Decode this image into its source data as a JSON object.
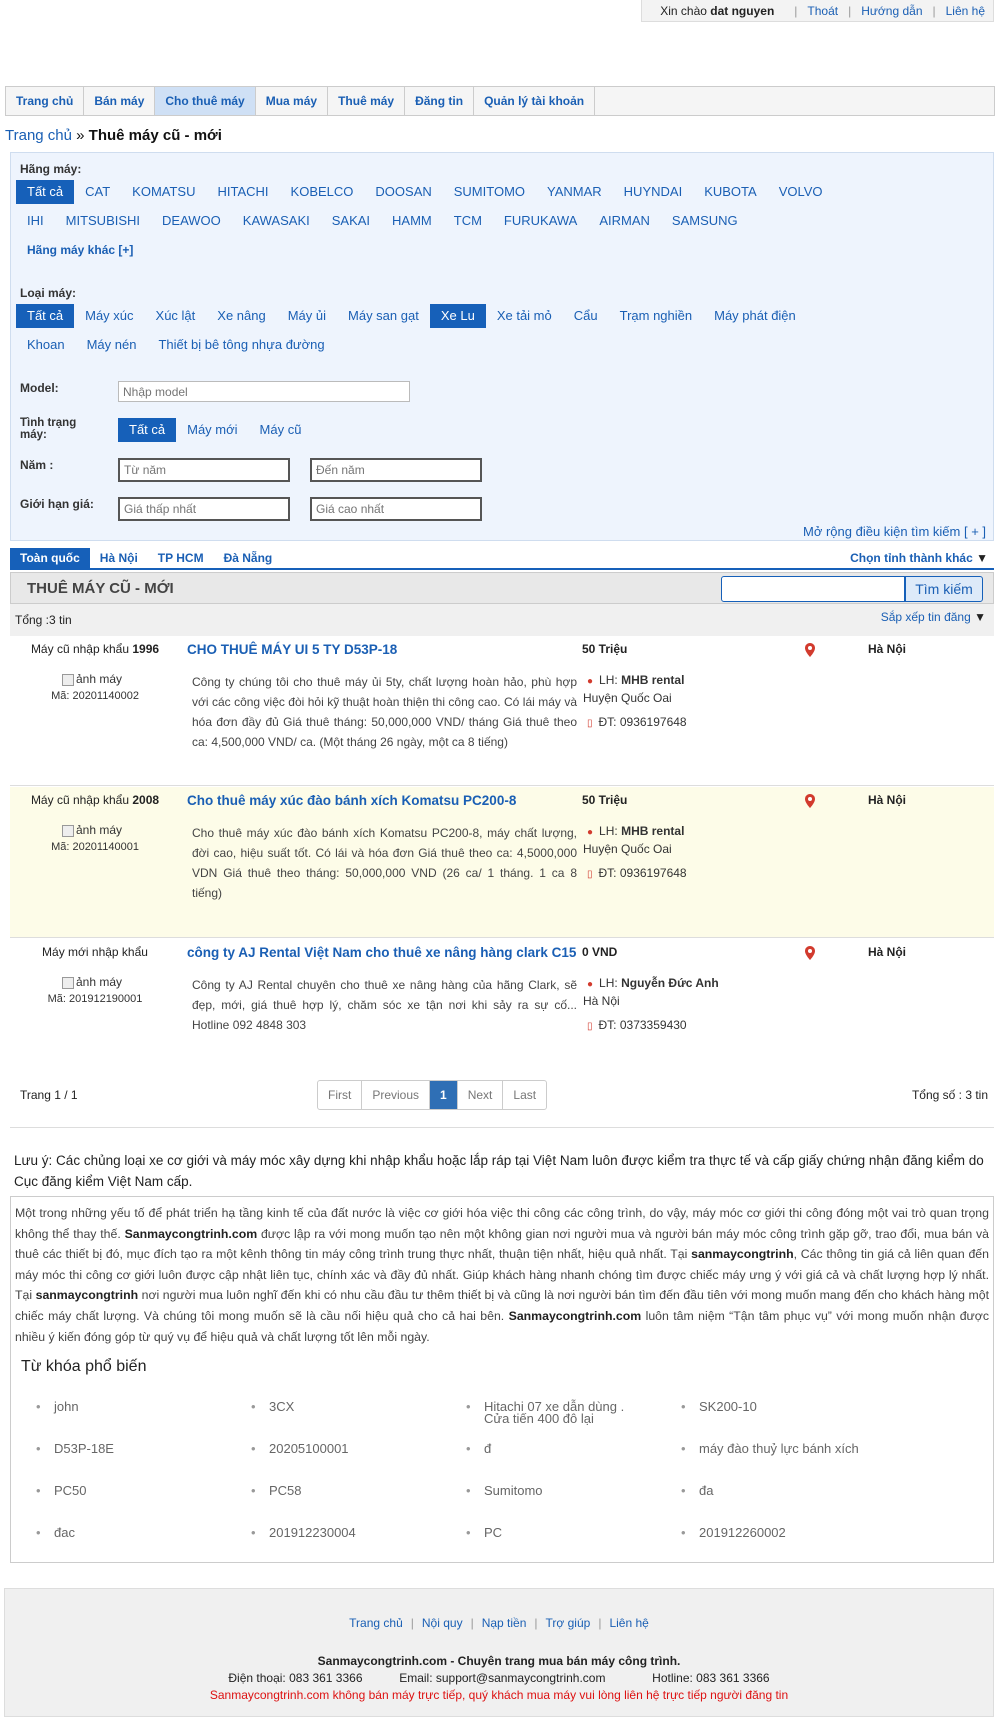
{
  "topbar": {
    "greeting": "Xin chào",
    "user": "dat nguyen",
    "logout": "Thoát",
    "guide": "Hướng dẫn",
    "contact": "Liên hệ"
  },
  "nav": [
    "Trang chủ",
    "Bán máy",
    "Cho thuê máy",
    "Mua máy",
    "Thuê máy",
    "Đăng tin",
    "Quản lý tài khoản"
  ],
  "breadcrumb": {
    "home": "Trang chủ",
    "sep": "»",
    "current": "Thuê máy cũ - mới"
  },
  "filters": {
    "brand_label": "Hãng máy:",
    "brands_row1": [
      "Tất cả",
      "CAT",
      "KOMATSU",
      "HITACHI",
      "KOBELCO",
      "DOOSAN",
      "SUMITOMO",
      "YANMAR",
      "HUYNDAI",
      "KUBOTA",
      "VOLVO"
    ],
    "brands_row2": [
      "IHI",
      "MITSUBISHI",
      "DEAWOO",
      "KAWASAKI",
      "SAKAI",
      "HAMM",
      "TCM",
      "FURUKAWA",
      "AIRMAN",
      "SAMSUNG"
    ],
    "brands_more": "Hãng máy khác [+]",
    "type_label": "Loại máy:",
    "types_row1": [
      "Tất cả",
      "Máy xúc",
      "Xúc lật",
      "Xe nâng",
      "Máy ủi",
      "Máy san gạt",
      "Xe Lu",
      "Xe tải mỏ",
      "Cẩu",
      "Trạm nghiền",
      "Máy phát điện"
    ],
    "types_row2": [
      "Khoan",
      "Máy nén",
      "Thiết bị bê tông nhựa đường"
    ],
    "model_label": "Model:",
    "model_placeholder": "Nhập model",
    "condition_label": "Tình trạng máy:",
    "conditions": [
      "Tất cả",
      "Máy mới",
      "Máy cũ"
    ],
    "year_label": "Năm :",
    "year_from": "Từ năm",
    "year_to": "Đến năm",
    "price_label": "Giới hạn giá:",
    "price_min": "Giá thấp nhất",
    "price_max": "Giá cao nhất",
    "expand": "Mở rộng điều kiện tìm kiếm [ + ]"
  },
  "regions": {
    "items": [
      "Toàn quốc",
      "Hà Nội",
      "TP HCM",
      "Đà Nẵng"
    ],
    "other": "Chọn tỉnh thành khác"
  },
  "list": {
    "title": "THUÊ MÁY CŨ - MỚI",
    "search_button": "Tìm kiếm",
    "total": "Tổng :3 tin",
    "sort": "Sắp xếp tin đăng"
  },
  "listings": [
    {
      "cond": "Máy cũ nhập khẩu",
      "year": "1996",
      "img_alt": "ảnh máy",
      "code": "Mã: 20201140002",
      "title": "CHO THUÊ MÁY UI 5 TY D53P-18",
      "desc": "Công ty chúng tôi cho thuê máy ủi 5ty, chất lượng hoàn hảo, phù hợp với các công việc đòi hỏi kỹ thuật hoàn thiện thi công cao. Có lái máy và hóa đơn đầy đủ Giá thuê tháng: 50,000,000 VND/ tháng Giá thuê theo ca: 4,500,000 VND/ ca. (Một tháng 26 ngày, một ca 8 tiếng)",
      "price": "50 Triệu",
      "contact_prefix": "LH:",
      "contact_name": "MHB rental",
      "address": "Huyện Quốc Oai",
      "phone": "ĐT: 0936197648",
      "location": "Hà Nội"
    },
    {
      "cond": "Máy cũ nhập khẩu",
      "year": "2008",
      "img_alt": "ảnh máy",
      "code": "Mã: 20201140001",
      "title": "Cho thuê máy xúc đào bánh xích Komatsu PC200-8",
      "desc": "Cho thuê máy xúc đào bánh xích Komatsu PC200-8, máy chất lượng, đời cao, hiệu suất tốt. Có lái và hóa đơn Giá thuê theo ca: 4,5000,000 VDN Giá thuê theo tháng: 50,000,000 VND (26 ca/ 1 tháng. 1 ca 8 tiếng)",
      "price": "50 Triệu",
      "contact_prefix": "LH:",
      "contact_name": "MHB rental",
      "address": "Huyện Quốc Oai",
      "phone": "ĐT: 0936197648",
      "location": "Hà Nội"
    },
    {
      "cond": "Máy mới nhập khẩu",
      "year": "",
      "img_alt": "ảnh máy",
      "code": "Mã: 201912190001",
      "title": "công ty AJ Rental Việt Nam cho thuê xe nâng hàng clark C15",
      "desc": "Công ty AJ Rental chuyên cho thuê xe nâng hàng của hãng Clark, sẽ đẹp, mới, giá thuê hợp lý, chăm sóc xe tận nơi khi sảy ra sự cố... Hotline 092 4848 303",
      "price": "0 VND",
      "contact_prefix": "LH:",
      "contact_name": "Nguyễn Đức Anh",
      "address": "Hà Nội",
      "phone": "ĐT: 0373359430",
      "location": "Hà Nội"
    }
  ],
  "pager": {
    "info": "Trang 1 / 1",
    "pages": [
      "First",
      "Previous",
      "1",
      "Next",
      "Last"
    ],
    "total": "Tổng số : 3 tin"
  },
  "note": "Lưu ý: Các chủng loại xe cơ giới và máy móc xây dựng khi nhập khẩu hoặc lắp ráp tại Việt Nam luôn được kiểm tra thực tế và cấp giấy chứng nhận đăng kiểm do Cục đăng kiểm Việt Nam cấp.",
  "seo": {
    "s1": "Một trong những yếu tố để phát triển hạ tầng kinh tế của đất nước là việc cơ giới hóa việc thi công các công trình, do vậy, máy móc cơ giới thi công đóng một vai trò quan trọng không thể thay thế.",
    "b1": "Sanmaycongtrinh.com",
    "s2": "được lập ra với mong muốn tạo nên một không gian nơi người mua và người bán máy móc công trình gặp gỡ, trao đổi, mua bán và thuê các thiết bị đó, mục đích tạo ra một kênh thông tin máy công trình trung thực nhất, thuận tiện nhất, hiệu quả nhất. Tại",
    "b2": "sanmaycongtrinh",
    "s3": ", Các thông tin giá cả liên quan đến máy móc thi công cơ giới luôn được cập nhật liên tục, chính xác và đầy đủ nhất. Giúp khách hàng nhanh chóng tìm được chiếc máy ưng ý với giá cả và chất lượng hợp lý nhất. Tại",
    "b3": "sanmaycongtrinh",
    "s4": "nơi người mua luôn nghĩ đến khi có nhu cầu đầu tư thêm thiết bị và cũng là nơi người bán tìm đến đầu tiên với mong muốn mang đến cho khách hàng một chiếc máy chất lượng. Và chúng tôi mong muốn sẽ là cầu nối hiệu quả cho cả hai bên.",
    "b4": "Sanmaycongtrinh.com",
    "s5": "luôn tâm niệm “Tận tâm phục vụ” với mong muốn nhận được nhiều ý kiến đóng góp từ quý vụ để hiệu quả và chất lượng tốt lên mỗi ngày.",
    "kw_title": "Từ khóa phổ biến",
    "keywords": [
      "john",
      "3CX",
      "Hitachi 07 xe dẫn dùng . Cửa tiến 400 đô lại",
      "SK200-10",
      "D53P-18E",
      "20205100001",
      "đ",
      "máy đào thuỷ lực bánh xích",
      "PC50",
      "PC58",
      "Sumitomo",
      "đa",
      "đac",
      "201912230004",
      "PC",
      "201912260002"
    ]
  },
  "footer": {
    "links": [
      "Trang chủ",
      "Nội quy",
      "Nạp tiền",
      "Trợ giúp",
      "Liên hệ"
    ],
    "line1": "Sanmaycongtrinh.com - Chuyên trang mua bán máy công trình.",
    "phone": "Điện thoại: 083 361 3366",
    "email": "Email: support@sanmaycongtrinh.com",
    "hotline": "Hotline: 083 361 3366",
    "warning": "Sanmaycongtrinh.com không bán máy trực tiếp, quý khách mua máy vui lòng liên hệ trực tiếp người đăng tin"
  },
  "colors": {
    "accent": "#1660b9",
    "link": "#1a5fb4",
    "filter_bg": "#eef4fd",
    "alt_row": "#fdfce8",
    "warning": "#dd1111"
  }
}
